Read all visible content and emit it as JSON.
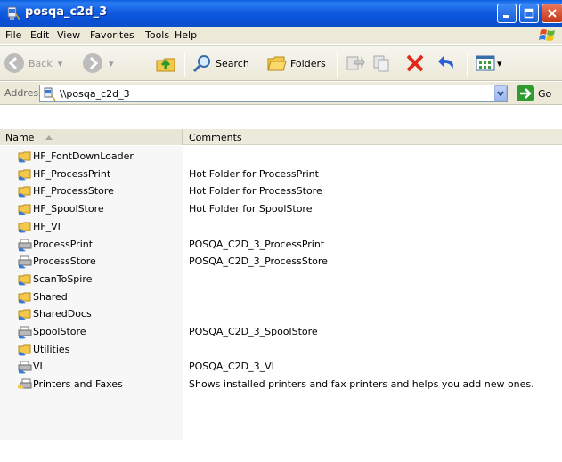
{
  "window": {
    "title": "posqa_c2d_3"
  },
  "menu": {
    "file": "File",
    "edit": "Edit",
    "view": "View",
    "favorites": "Favorites",
    "tools": "Tools",
    "help": "Help"
  },
  "toolbar": {
    "back": "Back",
    "search": "Search",
    "folders": "Folders"
  },
  "address": {
    "label": "Address",
    "value": "\\\\posqa_c2d_3",
    "go": "Go"
  },
  "columns": {
    "name": "Name",
    "comments": "Comments"
  },
  "rows": [
    {
      "name": "HF_FontDownLoader",
      "comment": "",
      "icon": "shared-folder-icon"
    },
    {
      "name": "HF_ProcessPrint",
      "comment": "Hot Folder for ProcessPrint",
      "icon": "shared-folder-icon"
    },
    {
      "name": "HF_ProcessStore",
      "comment": "Hot Folder for ProcessStore",
      "icon": "shared-folder-icon"
    },
    {
      "name": "HF_SpoolStore",
      "comment": "Hot Folder for SpoolStore",
      "icon": "shared-folder-icon"
    },
    {
      "name": "HF_VI",
      "comment": "",
      "icon": "shared-folder-icon"
    },
    {
      "name": "ProcessPrint",
      "comment": "POSQA_C2D_3_ProcessPrint",
      "icon": "shared-printer-icon"
    },
    {
      "name": "ProcessStore",
      "comment": "POSQA_C2D_3_ProcessStore",
      "icon": "shared-printer-icon"
    },
    {
      "name": "ScanToSpire",
      "comment": "",
      "icon": "shared-folder-icon"
    },
    {
      "name": "Shared",
      "comment": "",
      "icon": "shared-folder-icon"
    },
    {
      "name": "SharedDocs",
      "comment": "",
      "icon": "shared-folder-icon"
    },
    {
      "name": "SpoolStore",
      "comment": "POSQA_C2D_3_SpoolStore",
      "icon": "shared-printer-icon"
    },
    {
      "name": "Utilities",
      "comment": "",
      "icon": "shared-folder-icon"
    },
    {
      "name": "VI",
      "comment": "POSQA_C2D_3_VI",
      "icon": "shared-printer-icon"
    },
    {
      "name": "Printers and Faxes",
      "comment": "Shows installed printers and fax printers and helps you add new ones.",
      "icon": "printers-and-faxes-icon"
    }
  ],
  "colors": {
    "titlebar": "#0a50d6",
    "chrome": "#ece9d8"
  }
}
